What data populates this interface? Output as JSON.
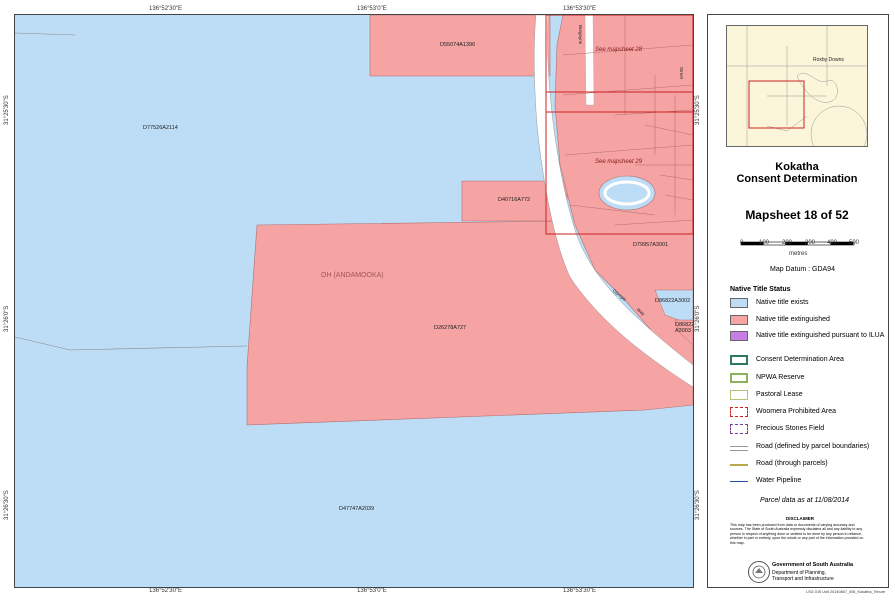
{
  "map": {
    "top_coords": [
      "136°52'30\"E",
      "136°53'0\"E",
      "136°53'30\"E"
    ],
    "bottom_coords": [
      "136°52'30\"E",
      "136°53'0\"E",
      "136°53'30\"E"
    ],
    "left_coords": [
      "31°25'30\"S",
      "31°26'0\"S",
      "31°26'30\"S"
    ],
    "right_coords": [
      "31°25'30\"S",
      "31°26'0\"S",
      "31°26'30\"S"
    ],
    "parcels": {
      "d55074": "D55074A1396",
      "d77526": "D77526A2114",
      "d40716": "D40716A772",
      "d79957": "D79957A3001",
      "d26278": "D26278A727",
      "d86822_1": "D86822A3002",
      "d86822_2": "D86822 A3003",
      "d47747": "D47747A2039",
      "oh": "OH (ANDAMOOKA)"
    },
    "see_mapsheet_28": "See mapsheet 28",
    "see_mapsheet_29": "See mapsheet 29",
    "road_burgoyne": "Burgoyne",
    "road_street": "Street",
    "road_olympic": "Olympic",
    "road_way": "Way",
    "colors": {
      "exists": "#bddcf5",
      "extinguished": "#f5a3a3",
      "ilua": "#c77de3"
    }
  },
  "panel": {
    "inset_label": "Roxby Downs",
    "title_line1": "Kokatha",
    "title_line2": "Consent Determination",
    "mapsheet": "Mapsheet 18 of 52",
    "scale_ticks": [
      "0",
      "100",
      "200",
      "300",
      "400",
      "500"
    ],
    "scale_unit": "metres",
    "datum": "Map Datum : GDA94",
    "legend_title": "Native Title Status",
    "legend": [
      {
        "label": "Native title exists",
        "kind": "exists"
      },
      {
        "label": "Native title extinguished",
        "kind": "extinguished"
      },
      {
        "label": "Native title extinguished pursuant to ILUA",
        "kind": "ilua"
      },
      {
        "label": "Consent Determination Area",
        "kind": "cda"
      },
      {
        "label": "NPWA Reserve",
        "kind": "npwa"
      },
      {
        "label": "Pastoral Lease",
        "kind": "pastoral"
      },
      {
        "label": "Woomera Prohibited Area",
        "kind": "woomera"
      },
      {
        "label": "Precious Stones Field",
        "kind": "precious"
      },
      {
        "label": "Road (defined by parcel boundaries)",
        "kind": "road1"
      },
      {
        "label": "Road (through parcels)",
        "kind": "road2"
      },
      {
        "label": "Water Pipeline",
        "kind": "pipe"
      }
    ],
    "parcel_date": "Parcel data as at 11/08/2014",
    "disclaimer_title": "DISCLAIMER",
    "disclaimer_text": "This map has been produced from data or documents of varying accuracy and sources. The State of South Australia expressly disclaims all and any liability to any person in respect of anything done or omitted to be done by any person in reliance, whether in part or entirely, upon the whole or any part of the information provided on this map.",
    "gov_line1": "Government of South Australia",
    "gov_line2": "Department of Planning,",
    "gov_line3": "Transport and Infrastructure",
    "footer": "LSG GIS Unit  20140807_006_Kokatha_Tenure"
  }
}
